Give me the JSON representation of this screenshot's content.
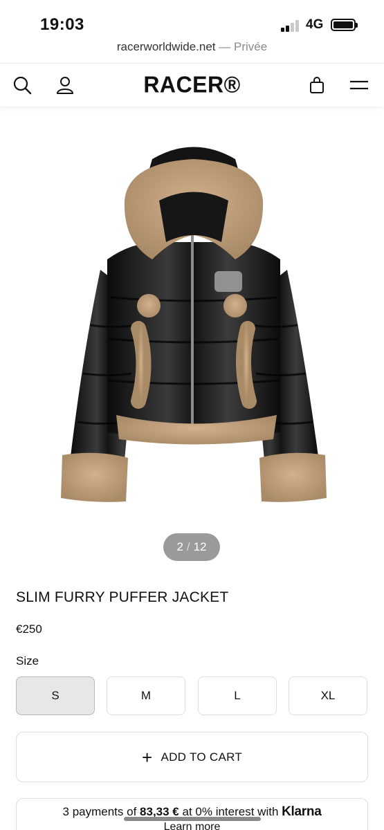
{
  "status_bar": {
    "time": "19:03",
    "network": "4G",
    "icons": [
      "signal-icon",
      "battery-icon"
    ]
  },
  "url_bar": {
    "domain": "racerworldwide.net",
    "separator": "—",
    "mode": "Privée"
  },
  "header": {
    "logo": "RACER®",
    "icons": [
      "search-icon",
      "account-icon",
      "cart-bag-icon",
      "menu-icon"
    ]
  },
  "gallery": {
    "current": "2",
    "separator": "/",
    "total": "12"
  },
  "product": {
    "title": "SLIM FURRY PUFFER JACKET",
    "price": "€250",
    "size_label": "Size",
    "sizes": [
      "S",
      "M",
      "L",
      "XL"
    ],
    "selected_size": "S"
  },
  "cart": {
    "add_label": "ADD TO CART"
  },
  "klarna": {
    "prefix": "3 payments of",
    "amount": "83,33 €",
    "suffix": "at 0% interest with",
    "brand": "Klarna",
    "learn_more": "Learn more"
  },
  "colors": {
    "text": "#111111",
    "border": "#dedede",
    "selected_bg": "#e7e7e7",
    "pager_bg": "#9a9a9a"
  }
}
